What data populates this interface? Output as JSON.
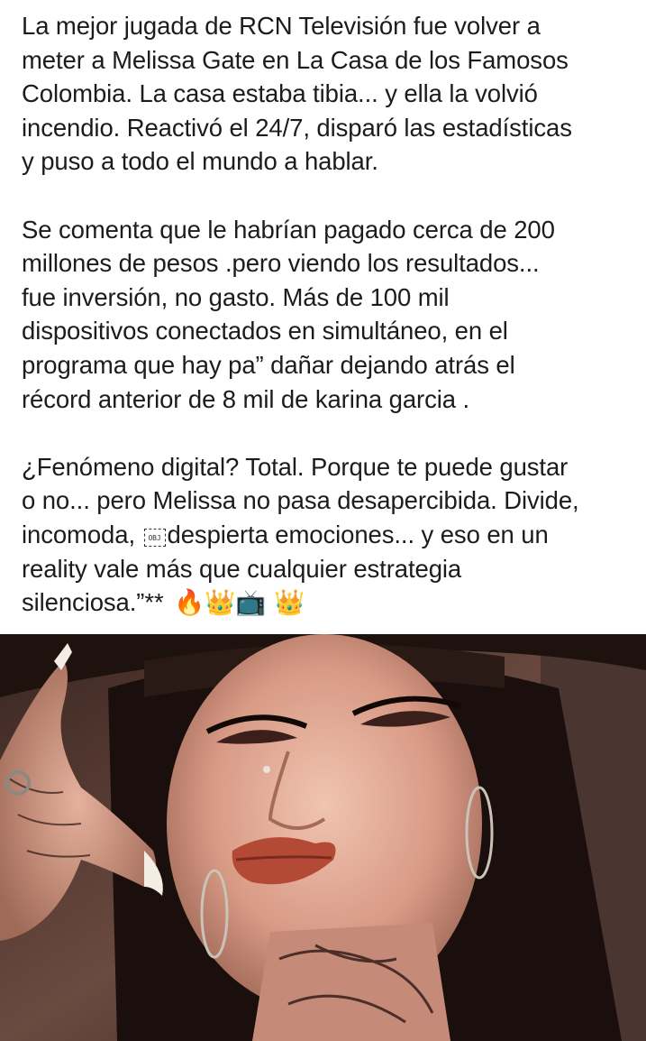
{
  "post": {
    "paragraphs": [
      {
        "lines": [
          "La mejor jugada de RCN Televisión fue volver a",
          "meter a Melissa Gate en La Casa de los Famosos",
          "Colombia. La casa estaba tibia... y ella la volvió",
          "incendio. Reactivó el 24/7, disparó las estadísticas",
          "y puso a todo el mundo a hablar."
        ]
      },
      {
        "lines": [
          "Se comenta que le habrían pagado cerca de 200",
          "millones de pesos .pero viendo los resultados...",
          "fue inversión, no gasto. Más de 100 mil",
          "dispositivos conectados en simultáneo, en el",
          "programa que hay pa” dañar dejando atrás el",
          "récord anterior de 8 mil de karina garcia ."
        ]
      },
      {
        "lines": [
          "¿Fenómeno digital? Total. Porque te puede gustar",
          "o no... pero Melissa no pasa desapercibida. Divide,",
          "despierta emociones... y eso en un",
          "reality vale más que cualquier estrategia",
          "silenciosa.”**"
        ],
        "inline_prefix": "incomoda, ",
        "obj_placeholder": "OBJ",
        "emojis": "🔥👑📺 👑"
      }
    ]
  },
  "photo": {
    "icon": "photo-of-woman-in-hat"
  }
}
